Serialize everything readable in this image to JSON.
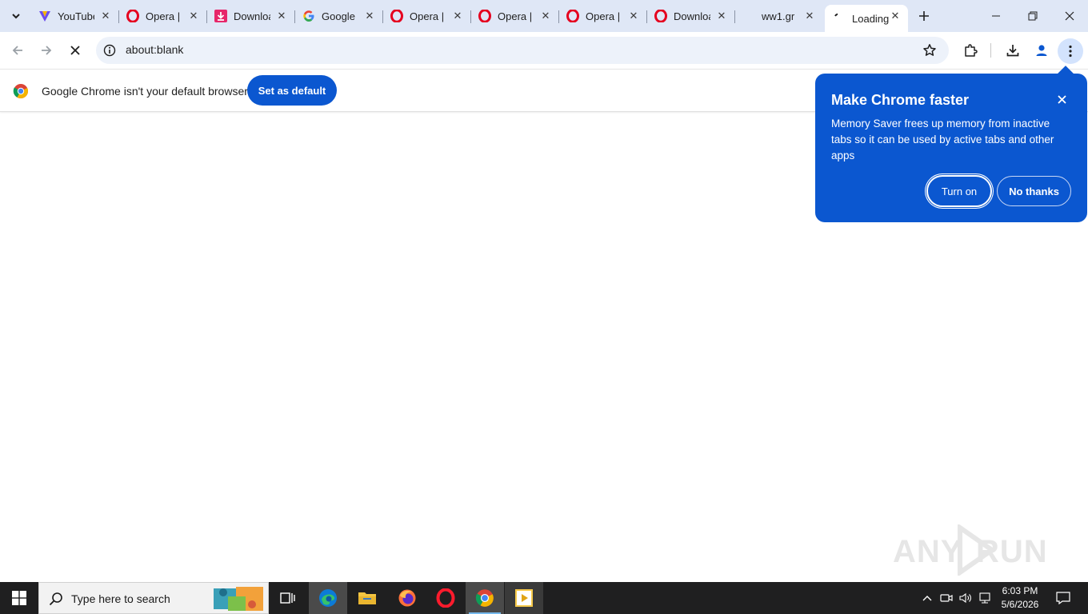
{
  "tabs": [
    {
      "title": "YouTube",
      "icon": "vpn-icon"
    },
    {
      "title": "Opera |",
      "icon": "opera-icon"
    },
    {
      "title": "Download",
      "icon": "download-icon"
    },
    {
      "title": "Google",
      "icon": "google-icon"
    },
    {
      "title": "Opera |",
      "icon": "opera-icon"
    },
    {
      "title": "Opera |",
      "icon": "opera-icon"
    },
    {
      "title": "Opera |",
      "icon": "opera-icon"
    },
    {
      "title": "Download",
      "icon": "opera-icon"
    },
    {
      "title": "ww1.gr",
      "icon": "blank-icon"
    },
    {
      "title": "Loading",
      "icon": "loading-icon",
      "active": true
    }
  ],
  "toolbar": {
    "url": "about:blank"
  },
  "infobar": {
    "message": "Google Chrome isn't your default browser",
    "button": "Set as default"
  },
  "bubble": {
    "title": "Make Chrome faster",
    "body": "Memory Saver frees up memory from inactive tabs so it can be used by active tabs and other apps",
    "primary": "Turn on",
    "secondary": "No thanks"
  },
  "watermark": {
    "left": "ANY",
    "right": "RUN"
  },
  "taskbar": {
    "search_placeholder": "Type here to search",
    "time": "6:03 PM",
    "date": "5/6/2026"
  },
  "colors": {
    "accent": "#0b57d0",
    "tabstrip": "#dfe7f6",
    "omnibox": "#edf2fa",
    "taskbar": "#1f1f20"
  }
}
